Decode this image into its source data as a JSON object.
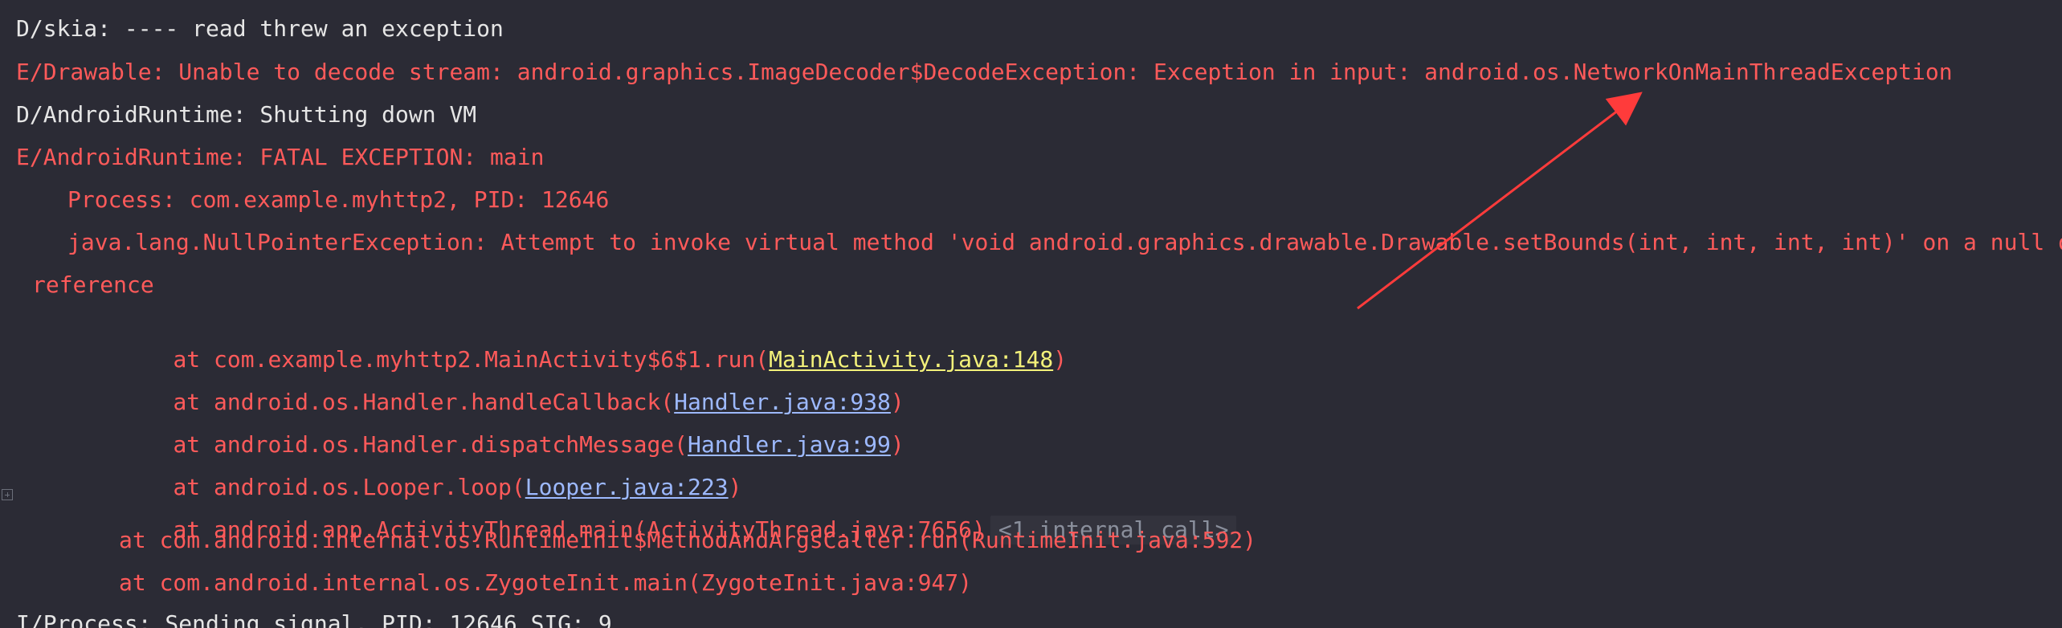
{
  "colors": {
    "background": "#2b2b35",
    "debug_text": "#e6e6e6",
    "error_text": "#ff5a5a",
    "link_blue": "#9db9ff",
    "link_yellow": "#f3f17a",
    "internal_call": "#8a8f9c",
    "annotation_arrow": "#ff3b3b"
  },
  "log": {
    "lines": [
      {
        "text": "D/skia: ---- read threw an exception"
      },
      {
        "text": "E/Drawable: Unable to decode stream: android.graphics.ImageDecoder$DecodeException: Exception in input: android.os.NetworkOnMainThreadException"
      },
      {
        "text": "D/AndroidRuntime: Shutting down VM"
      },
      {
        "text": "E/AndroidRuntime: FATAL EXCEPTION: main"
      },
      {
        "text": "Process: com.example.myhttp2, PID: 12646"
      },
      {
        "text": "java.lang.NullPointerException: Attempt to invoke virtual method 'void android.graphics.drawable.Drawable.setBounds(int, int, int, int)' on a null object"
      },
      {
        "text": "reference"
      }
    ],
    "stack": [
      {
        "prefix": "at com.example.myhttp2.MainActivity$6$1.run(",
        "link": "MainActivity.java:148",
        "suffix": ")"
      },
      {
        "prefix": "at android.os.Handler.handleCallback(",
        "link": "Handler.java:938",
        "suffix": ")"
      },
      {
        "prefix": "at android.os.Handler.dispatchMessage(",
        "link": "Handler.java:99",
        "suffix": ")"
      },
      {
        "prefix": "at android.os.Looper.loop(",
        "link": "Looper.java:223",
        "suffix": ")"
      },
      {
        "text": "at android.app.ActivityThread.main(ActivityThread.java:7656)",
        "internal": "<1 internal call>"
      },
      {
        "text": "at com.android.internal.os.RuntimeInit$MethodAndArgsCaller.run(RuntimeInit.java:592)"
      },
      {
        "text": "at com.android.internal.os.ZygoteInit.main(ZygoteInit.java:947)"
      }
    ],
    "last": {
      "text": "I/Process: Sending signal. PID: 12646 SIG: 9"
    }
  }
}
